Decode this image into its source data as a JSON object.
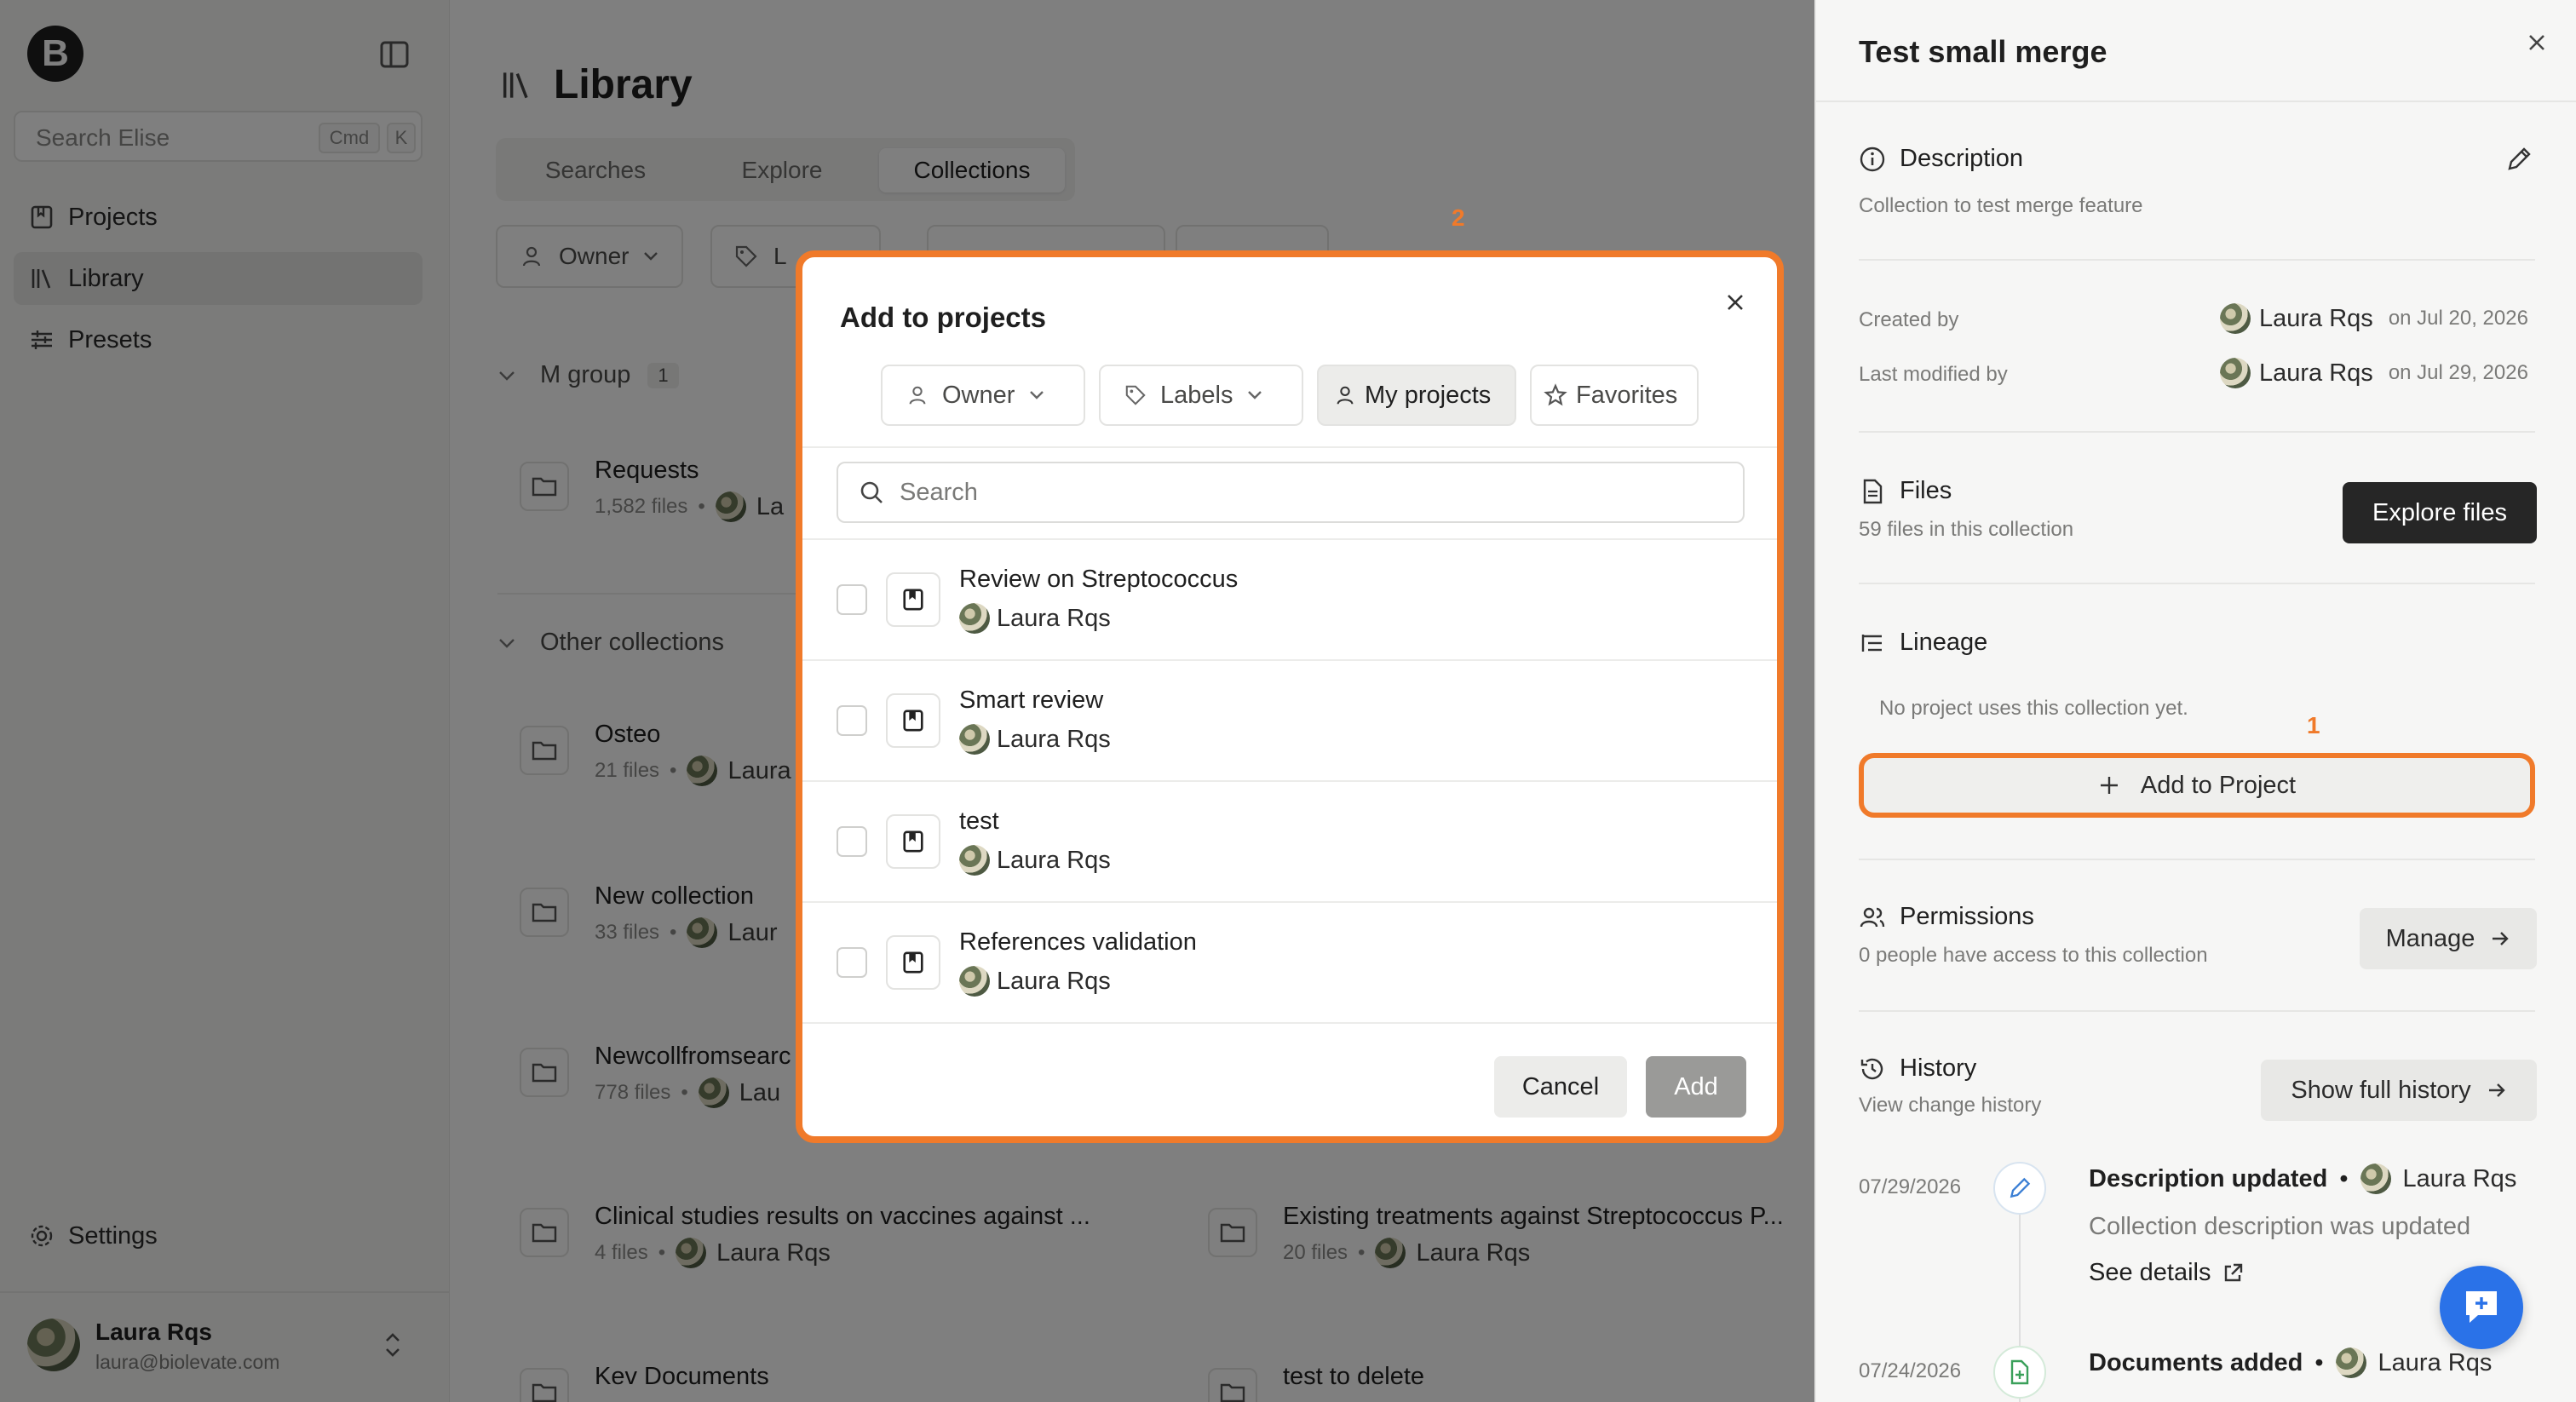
{
  "sidebar": {
    "logo_letter": "B",
    "search_placeholder": "Search Elise",
    "search_kbd_1": "Cmd",
    "search_kbd_2": "K",
    "nav": [
      {
        "label": "Projects",
        "icon": "bookmark-book-icon"
      },
      {
        "label": "Library",
        "icon": "library-icon"
      },
      {
        "label": "Presets",
        "icon": "sliders-icon"
      }
    ],
    "settings_label": "Settings",
    "user": {
      "name": "Laura Rqs",
      "email": "laura@biolevate.com"
    }
  },
  "library": {
    "title": "Library",
    "tabs": [
      "Searches",
      "Explore",
      "Collections"
    ],
    "active_tab": "Collections",
    "filters": {
      "owner": "Owner",
      "labels_partial": "L"
    },
    "groups": [
      {
        "label": "M group",
        "count": "1"
      },
      {
        "label": "Other collections"
      }
    ],
    "collections": [
      {
        "name": "Requests",
        "files": "1,582 files",
        "owner": "La"
      },
      {
        "name": "Osteo",
        "files": "21 files",
        "owner": "Laura"
      },
      {
        "name": "New collection",
        "files": "33 files",
        "owner": "Laur"
      },
      {
        "name": "Newcollfromsearc",
        "files": "778 files",
        "owner": "Lau"
      },
      {
        "name": "Clinical studies results on vaccines against ...",
        "files": "4 files",
        "owner": "Laura Rqs"
      },
      {
        "name": "Existing treatments against Streptococcus P...",
        "files": "20 files",
        "owner": "Laura Rqs"
      },
      {
        "name": "Kev Documents",
        "files": "",
        "owner": ""
      },
      {
        "name": "test to delete",
        "files": "",
        "owner": ""
      }
    ]
  },
  "modal": {
    "title": "Add to projects",
    "step_marker": "2",
    "filters": [
      "Owner",
      "Labels",
      "My projects",
      "Favorites"
    ],
    "active_filter": "My projects",
    "search_placeholder": "Search",
    "projects": [
      {
        "name": "Review on Streptococcus",
        "owner": "Laura Rqs"
      },
      {
        "name": "Smart review",
        "owner": "Laura Rqs"
      },
      {
        "name": "test",
        "owner": "Laura Rqs"
      },
      {
        "name": "References validation",
        "owner": "Laura Rqs"
      }
    ],
    "cancel_label": "Cancel",
    "add_label": "Add"
  },
  "panel": {
    "title": "Test small merge",
    "description": {
      "title": "Description",
      "text": "Collection to test merge feature"
    },
    "created_by": {
      "label": "Created by",
      "user": "Laura Rqs",
      "date": "on Jul 20, 2026"
    },
    "modified_by": {
      "label": "Last modified by",
      "user": "Laura Rqs",
      "date": "on Jul 29, 2026"
    },
    "files": {
      "title": "Files",
      "sub": "59 files in this collection",
      "button": "Explore files"
    },
    "lineage": {
      "title": "Lineage",
      "empty": "No project uses this collection yet.",
      "marker": "1",
      "button": "Add to Project"
    },
    "permissions": {
      "title": "Permissions",
      "sub": "0 people have access to this collection",
      "button": "Manage"
    },
    "history": {
      "title": "History",
      "sub": "View change history",
      "button": "Show full history",
      "entries": [
        {
          "date": "07/29/2026",
          "title": "Description updated",
          "owner": "Laura Rqs",
          "desc": "Collection description was updated",
          "link": "See details"
        },
        {
          "date": "07/24/2026",
          "title": "Documents added",
          "owner": "Laura Rqs"
        }
      ]
    }
  },
  "colors": {
    "accent_orange": "#f07a2a",
    "fab_blue": "#2a72e8",
    "dark_button": "#262626"
  }
}
